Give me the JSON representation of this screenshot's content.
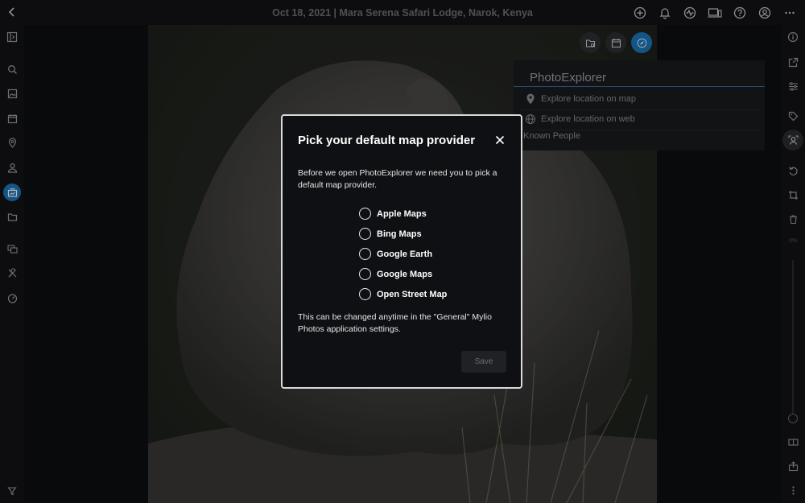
{
  "topbar": {
    "title": "Oct 18, 2021 | Mara Serena Safari Lodge, Narok, Kenya",
    "icons": [
      "add-icon",
      "bell-icon",
      "activity-icon",
      "devices-icon",
      "help-icon",
      "account-icon",
      "more-icon"
    ]
  },
  "leftbar": {
    "icons": [
      "sidebar-toggle-icon",
      "search-icon",
      "photos-icon",
      "calendar-icon",
      "map-pin-icon",
      "people-icon",
      "albums-icon",
      "folder-icon",
      "media-icon",
      "tools-icon",
      "dashboard-icon",
      "filter-icon"
    ],
    "active": "albums-icon"
  },
  "rightbar": {
    "icons": [
      "info-icon",
      "external-link-icon",
      "adjust-icon",
      "tag-icon",
      "face-icon",
      "rotate-icon",
      "crop-icon",
      "trash-icon",
      "card-icon",
      "export-icon",
      "more-vertical-icon"
    ],
    "zoom_label": "0%"
  },
  "photo_actions": [
    "folder-icon",
    "calendar-icon",
    "compass-icon"
  ],
  "menu": {
    "title": "PhotoExplorer",
    "items": [
      {
        "label": "Explore location on map",
        "icon": "map-pin-icon"
      },
      {
        "label": "Explore location on web",
        "icon": "globe-icon"
      }
    ],
    "known_people": "Known People"
  },
  "modal": {
    "title": "Pick your default map provider",
    "intro": "Before we open PhotoExplorer we need you to pick a default map provider.",
    "options": [
      "Apple Maps",
      "Bing Maps",
      "Google Earth",
      "Google Maps",
      "Open Street Map"
    ],
    "note": "This can be changed anytime in the \"General\" Mylio Photos application settings.",
    "save_label": "Save"
  },
  "colors": {
    "accent": "#1b76b8",
    "background": "#0d0e10",
    "modal_border": "#d9d9d9"
  }
}
